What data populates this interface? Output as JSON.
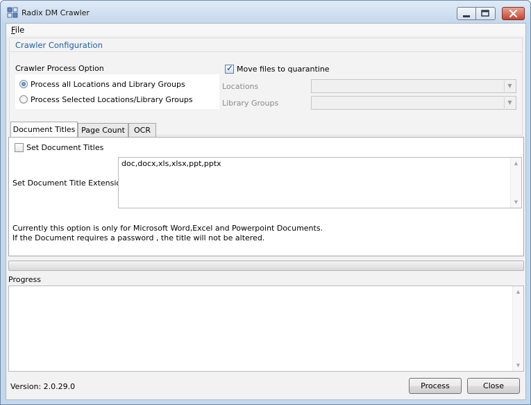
{
  "window": {
    "title": "Radix DM Crawler"
  },
  "menu": {
    "file": "File"
  },
  "config": {
    "title": "Crawler Configuration",
    "process_option_label": "Crawler Process Option",
    "radio_all": "Process all Locations and Library Groups",
    "radio_selected": "Process Selected Locations/Library Groups",
    "radio_all_selected": true,
    "move_quarantine_label": "Move files to quarantine",
    "move_quarantine_checked": true,
    "locations_label": "Locations",
    "library_groups_label": "Library Groups"
  },
  "tabs": [
    {
      "label": "Document Titles",
      "active": true
    },
    {
      "label": "Page Count",
      "active": false
    },
    {
      "label": "OCR",
      "active": false
    }
  ],
  "document_titles": {
    "set_titles_label": "Set Document Titles",
    "set_titles_checked": false,
    "extensions_label": "Set Document Title Extensions:",
    "extensions_value": "doc,docx,xls,xlsx,ppt,pptx",
    "note_line1": "Currently this option is only for Microsoft Word,Excel and Powerpoint Documents.",
    "note_line2": "If the Document requires a password , the title will not be altered."
  },
  "progress": {
    "label": "Progress",
    "value": 0
  },
  "footer": {
    "version": "Version: 2.0.29.0",
    "process_button": "Process",
    "close_button": "Close"
  },
  "colors": {
    "accent": "#1f5ea8",
    "frame": "#c4d7ec",
    "close": "#c5432f"
  },
  "icons": {
    "app": "app-grid-icon",
    "minimize": "minimize-icon",
    "maximize": "maximize-icon",
    "close": "close-icon"
  }
}
